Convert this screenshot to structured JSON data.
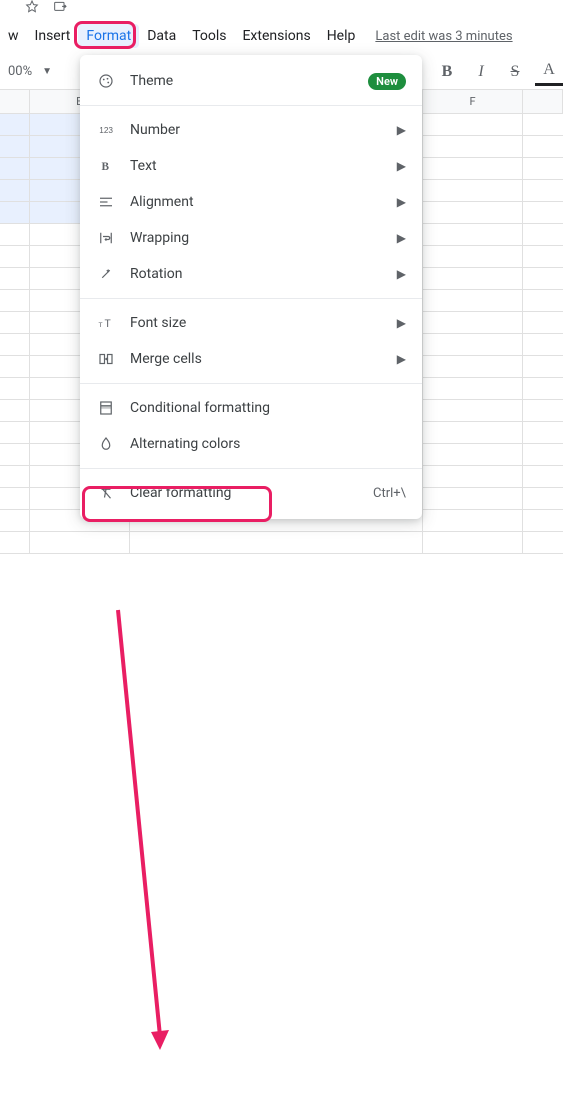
{
  "menubar": {
    "items": [
      "w",
      "Insert",
      "Format",
      "Data",
      "Tools",
      "Extensions",
      "Help"
    ],
    "active_index": 2,
    "last_edit": "Last edit was 3 minutes"
  },
  "toolbar": {
    "zoom": "00%",
    "bold": "B",
    "italic": "I",
    "strike": "S",
    "textcolor": "A"
  },
  "columns": {
    "b": "B",
    "f": "F"
  },
  "menu": {
    "theme": {
      "label": "Theme",
      "badge": "New"
    },
    "number": {
      "label": "Number"
    },
    "text": {
      "label": "Text"
    },
    "alignment": {
      "label": "Alignment"
    },
    "wrapping": {
      "label": "Wrapping"
    },
    "rotation": {
      "label": "Rotation"
    },
    "fontsize": {
      "label": "Font size"
    },
    "mergecells": {
      "label": "Merge cells"
    },
    "conditional": {
      "label": "Conditional formatting"
    },
    "alternating": {
      "label": "Alternating colors"
    },
    "clear": {
      "label": "Clear formatting",
      "shortcut": "Ctrl+\\"
    }
  },
  "annotation": {
    "from": "Format menu",
    "to": "Clear formatting"
  }
}
